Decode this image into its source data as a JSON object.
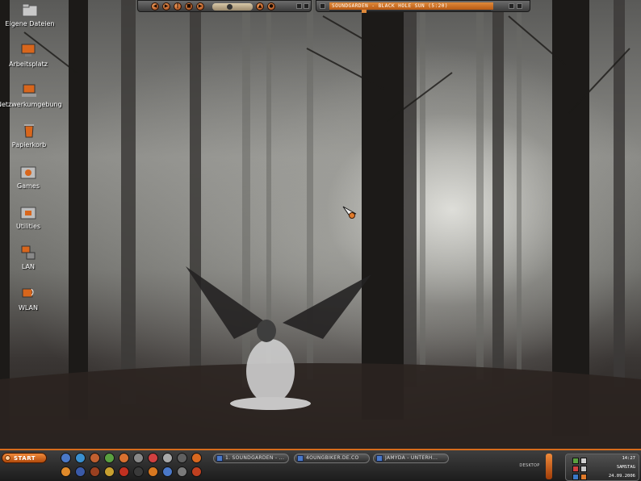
{
  "desktop": {
    "icons": [
      {
        "label": "Eigene Dateien",
        "icon": "folder-icon"
      },
      {
        "label": "Arbeitsplatz",
        "icon": "computer-icon"
      },
      {
        "label": "Netzwerkumgebung",
        "icon": "network-icon"
      },
      {
        "label": "Papierkorb",
        "icon": "recycle-bin-icon"
      },
      {
        "label": "Games",
        "icon": "games-folder-icon"
      },
      {
        "label": "Utilities",
        "icon": "utilities-folder-icon"
      },
      {
        "label": "LAN",
        "icon": "lan-icon"
      },
      {
        "label": "WLAN",
        "icon": "wlan-icon"
      }
    ]
  },
  "player": {
    "now_playing": "SOUNDGARDEN - BLACK HOLE SUN (5:20)",
    "buttons": [
      "prev",
      "play",
      "pause",
      "stop",
      "next",
      "eject"
    ]
  },
  "taskbar": {
    "start_label": "START",
    "tasks": [
      {
        "label": "1. SOUNDGARDEN - ..."
      },
      {
        "label": "4OUNGBIKER.DE.CO"
      },
      {
        "label": "JAMYDA - UNTERH..."
      }
    ],
    "desktop_label": "DESKTOP",
    "clock": {
      "time": "14:27",
      "day": "SAMSTAG",
      "date": "24.09.2006"
    }
  },
  "colors": {
    "accent": "#e07a2a",
    "taskbar": "#2a2a2a"
  }
}
